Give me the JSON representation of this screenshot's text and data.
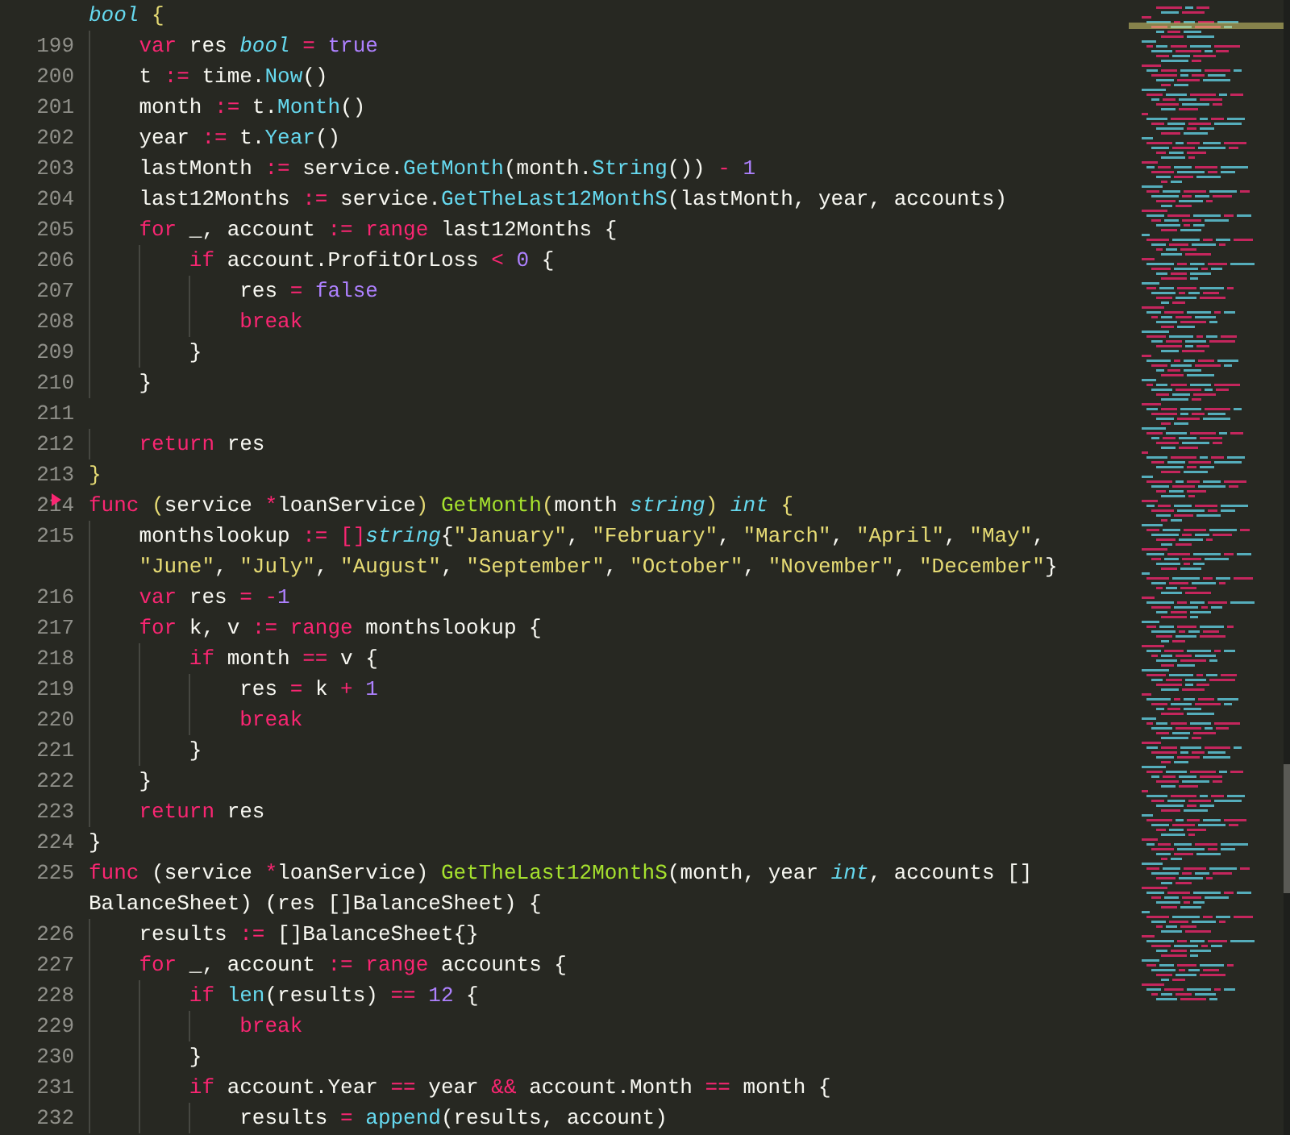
{
  "lines": [
    {
      "marked": false,
      "tokens": [
        {
          "kind": "type",
          "text": "bool "
        },
        {
          "kind": "brace",
          "text": "{"
        }
      ]
    },
    {
      "number": "199",
      "marked": false,
      "tokens": [
        {
          "kind": "kw",
          "text": "    var"
        },
        {
          "kind": "p",
          "text": " res "
        },
        {
          "kind": "type",
          "text": "bool "
        },
        {
          "kind": "op",
          "text": "= "
        },
        {
          "kind": "num",
          "text": "true"
        }
      ]
    },
    {
      "number": "200",
      "marked": false,
      "tokens": [
        {
          "kind": "p",
          "text": "    t "
        },
        {
          "kind": "op",
          "text": ":="
        },
        {
          "kind": "p",
          "text": " time."
        },
        {
          "kind": "call",
          "text": "Now"
        },
        {
          "kind": "p",
          "text": "()"
        }
      ]
    },
    {
      "number": "201",
      "marked": false,
      "tokens": [
        {
          "kind": "p",
          "text": "    month "
        },
        {
          "kind": "op",
          "text": ":="
        },
        {
          "kind": "p",
          "text": " t."
        },
        {
          "kind": "call",
          "text": "Month"
        },
        {
          "kind": "p",
          "text": "()"
        }
      ]
    },
    {
      "number": "202",
      "marked": false,
      "tokens": [
        {
          "kind": "p",
          "text": "    year "
        },
        {
          "kind": "op",
          "text": ":="
        },
        {
          "kind": "p",
          "text": " t."
        },
        {
          "kind": "call",
          "text": "Year"
        },
        {
          "kind": "p",
          "text": "()"
        }
      ]
    },
    {
      "number": "203",
      "marked": false,
      "tokens": [
        {
          "kind": "p",
          "text": "    lastMonth "
        },
        {
          "kind": "op",
          "text": ":="
        },
        {
          "kind": "p",
          "text": " service."
        },
        {
          "kind": "call",
          "text": "GetMonth"
        },
        {
          "kind": "p",
          "text": "(month."
        },
        {
          "kind": "call",
          "text": "String"
        },
        {
          "kind": "p",
          "text": "()) "
        },
        {
          "kind": "op",
          "text": "- "
        },
        {
          "kind": "num",
          "text": "1"
        }
      ]
    },
    {
      "number": "204",
      "marked": false,
      "tokens": [
        {
          "kind": "p",
          "text": "    last12Months "
        },
        {
          "kind": "op",
          "text": ":="
        },
        {
          "kind": "p",
          "text": " service."
        },
        {
          "kind": "call",
          "text": "GetTheLast12MonthS"
        },
        {
          "kind": "p",
          "text": "(lastMonth, year, accounts)"
        }
      ]
    },
    {
      "number": "205",
      "marked": false,
      "tokens": [
        {
          "kind": "kw",
          "text": "    for"
        },
        {
          "kind": "p",
          "text": " _, account "
        },
        {
          "kind": "op",
          "text": ":= "
        },
        {
          "kind": "kw",
          "text": "range"
        },
        {
          "kind": "p",
          "text": " last12Months {"
        }
      ]
    },
    {
      "number": "206",
      "marked": false,
      "tokens": [
        {
          "kind": "kw",
          "text": "        if"
        },
        {
          "kind": "p",
          "text": " account.ProfitOrLoss "
        },
        {
          "kind": "op",
          "text": "< "
        },
        {
          "kind": "num",
          "text": "0"
        },
        {
          "kind": "p",
          "text": " {"
        }
      ]
    },
    {
      "number": "207",
      "marked": false,
      "tokens": [
        {
          "kind": "p",
          "text": "            res "
        },
        {
          "kind": "op",
          "text": "= "
        },
        {
          "kind": "num",
          "text": "false"
        }
      ]
    },
    {
      "number": "208",
      "marked": false,
      "tokens": [
        {
          "kind": "kw",
          "text": "            break"
        }
      ]
    },
    {
      "number": "209",
      "marked": false,
      "tokens": [
        {
          "kind": "p",
          "text": "        }"
        }
      ]
    },
    {
      "number": "210",
      "marked": false,
      "tokens": [
        {
          "kind": "p",
          "text": "    }"
        }
      ]
    },
    {
      "number": "211",
      "marked": false
    },
    {
      "number": "212",
      "marked": false,
      "tokens": [
        {
          "kind": "kw",
          "text": "    return"
        },
        {
          "kind": "p",
          "text": " res"
        }
      ]
    },
    {
      "number": "213",
      "marked": false,
      "tokens": [
        {
          "kind": "brace",
          "text": "}"
        }
      ]
    },
    {
      "number": "214",
      "marked": true,
      "tokens": [
        {
          "kind": "kw",
          "text": "func "
        },
        {
          "kind": "brace",
          "text": "("
        },
        {
          "kind": "p",
          "text": "service "
        },
        {
          "kind": "op",
          "text": "*"
        },
        {
          "kind": "p",
          "text": "loanService"
        },
        {
          "kind": "brace",
          "text": ") "
        },
        {
          "kind": "fn",
          "text": "GetMonth"
        },
        {
          "kind": "brace",
          "text": "("
        },
        {
          "kind": "p",
          "text": "month "
        },
        {
          "kind": "type",
          "text": "string"
        },
        {
          "kind": "brace",
          "text": ") "
        },
        {
          "kind": "type",
          "text": "int "
        },
        {
          "kind": "brace",
          "text": "{"
        }
      ]
    },
    {
      "number": "215",
      "marked": false,
      "tokens": [
        {
          "kind": "p",
          "text": "    monthslookup "
        },
        {
          "kind": "op",
          "text": ":= []"
        },
        {
          "kind": "type",
          "text": "string"
        },
        {
          "kind": "p",
          "text": "{"
        },
        {
          "kind": "str",
          "text": "\"January\""
        },
        {
          "kind": "p",
          "text": ", "
        },
        {
          "kind": "str",
          "text": "\"February\""
        },
        {
          "kind": "p",
          "text": ", "
        },
        {
          "kind": "str",
          "text": "\"March\""
        },
        {
          "kind": "p",
          "text": ", "
        },
        {
          "kind": "str",
          "text": "\"April\""
        },
        {
          "kind": "p",
          "text": ", "
        },
        {
          "kind": "str",
          "text": "\"May\""
        },
        {
          "kind": "p",
          "text": ","
        }
      ]
    },
    {
      "marked": false,
      "tokens": [
        {
          "kind": "str",
          "text": "    \"June\""
        },
        {
          "kind": "p",
          "text": ", "
        },
        {
          "kind": "str",
          "text": "\"July\""
        },
        {
          "kind": "p",
          "text": ", "
        },
        {
          "kind": "str",
          "text": "\"August\""
        },
        {
          "kind": "p",
          "text": ", "
        },
        {
          "kind": "str",
          "text": "\"September\""
        },
        {
          "kind": "p",
          "text": ", "
        },
        {
          "kind": "str",
          "text": "\"October\""
        },
        {
          "kind": "p",
          "text": ", "
        },
        {
          "kind": "str",
          "text": "\"November\""
        },
        {
          "kind": "p",
          "text": ", "
        },
        {
          "kind": "str",
          "text": "\"December\""
        },
        {
          "kind": "p",
          "text": "}"
        }
      ]
    },
    {
      "number": "216",
      "marked": false,
      "tokens": [
        {
          "kind": "kw",
          "text": "    var"
        },
        {
          "kind": "p",
          "text": " res "
        },
        {
          "kind": "op",
          "text": "= -"
        },
        {
          "kind": "num",
          "text": "1"
        }
      ]
    },
    {
      "number": "217",
      "marked": false,
      "tokens": [
        {
          "kind": "kw",
          "text": "    for"
        },
        {
          "kind": "p",
          "text": " k, v "
        },
        {
          "kind": "op",
          "text": ":= "
        },
        {
          "kind": "kw",
          "text": "range"
        },
        {
          "kind": "p",
          "text": " monthslookup {"
        }
      ]
    },
    {
      "number": "218",
      "marked": false,
      "tokens": [
        {
          "kind": "kw",
          "text": "        if"
        },
        {
          "kind": "p",
          "text": " month "
        },
        {
          "kind": "op",
          "text": "=="
        },
        {
          "kind": "p",
          "text": " v {"
        }
      ]
    },
    {
      "number": "219",
      "marked": false,
      "tokens": [
        {
          "kind": "p",
          "text": "            res "
        },
        {
          "kind": "op",
          "text": "="
        },
        {
          "kind": "p",
          "text": " k "
        },
        {
          "kind": "op",
          "text": "+ "
        },
        {
          "kind": "num",
          "text": "1"
        }
      ]
    },
    {
      "number": "220",
      "marked": false,
      "tokens": [
        {
          "kind": "kw",
          "text": "            break"
        }
      ]
    },
    {
      "number": "221",
      "marked": false,
      "tokens": [
        {
          "kind": "p",
          "text": "        }"
        }
      ]
    },
    {
      "number": "222",
      "marked": false,
      "tokens": [
        {
          "kind": "p",
          "text": "    }"
        }
      ]
    },
    {
      "number": "223",
      "marked": false,
      "tokens": [
        {
          "kind": "kw",
          "text": "    return"
        },
        {
          "kind": "p",
          "text": " res"
        }
      ]
    },
    {
      "number": "224",
      "marked": false,
      "tokens": [
        {
          "kind": "p",
          "text": "}"
        }
      ]
    },
    {
      "number": "225",
      "marked": false,
      "tokens": [
        {
          "kind": "kw",
          "text": "func"
        },
        {
          "kind": "p",
          "text": " (service "
        },
        {
          "kind": "op",
          "text": "*"
        },
        {
          "kind": "p",
          "text": "loanService) "
        },
        {
          "kind": "fn",
          "text": "GetTheLast12MonthS"
        },
        {
          "kind": "p",
          "text": "(month, year "
        },
        {
          "kind": "type",
          "text": "int"
        },
        {
          "kind": "p",
          "text": ", accounts []"
        }
      ]
    },
    {
      "marked": false,
      "tokens": [
        {
          "kind": "p",
          "text": "BalanceSheet) (res []BalanceSheet) {"
        }
      ]
    },
    {
      "number": "226",
      "marked": false,
      "tokens": [
        {
          "kind": "p",
          "text": "    results "
        },
        {
          "kind": "op",
          "text": ":="
        },
        {
          "kind": "p",
          "text": " []BalanceSheet{}"
        }
      ]
    },
    {
      "number": "227",
      "marked": false,
      "tokens": [
        {
          "kind": "kw",
          "text": "    for"
        },
        {
          "kind": "p",
          "text": " _, account "
        },
        {
          "kind": "op",
          "text": ":= "
        },
        {
          "kind": "kw",
          "text": "range"
        },
        {
          "kind": "p",
          "text": " accounts {"
        }
      ]
    },
    {
      "number": "228",
      "marked": false,
      "tokens": [
        {
          "kind": "kw",
          "text": "        if "
        },
        {
          "kind": "call",
          "text": "len"
        },
        {
          "kind": "p",
          "text": "(results) "
        },
        {
          "kind": "op",
          "text": "== "
        },
        {
          "kind": "num",
          "text": "12"
        },
        {
          "kind": "p",
          "text": " {"
        }
      ]
    },
    {
      "number": "229",
      "marked": false,
      "tokens": [
        {
          "kind": "kw",
          "text": "            break"
        }
      ]
    },
    {
      "number": "230",
      "marked": false,
      "tokens": [
        {
          "kind": "p",
          "text": "        }"
        }
      ]
    },
    {
      "number": "231",
      "marked": false,
      "tokens": [
        {
          "kind": "kw",
          "text": "        if"
        },
        {
          "kind": "p",
          "text": " account.Year "
        },
        {
          "kind": "op",
          "text": "=="
        },
        {
          "kind": "p",
          "text": " year "
        },
        {
          "kind": "op",
          "text": "&&"
        },
        {
          "kind": "p",
          "text": " account.Month "
        },
        {
          "kind": "op",
          "text": "=="
        },
        {
          "kind": "p",
          "text": " month {"
        }
      ]
    },
    {
      "number": "232",
      "marked": false,
      "tokens": [
        {
          "kind": "p",
          "text": "            results "
        },
        {
          "kind": "op",
          "text": "= "
        },
        {
          "kind": "call",
          "text": "append"
        },
        {
          "kind": "p",
          "text": "(results, account)"
        }
      ]
    }
  ]
}
